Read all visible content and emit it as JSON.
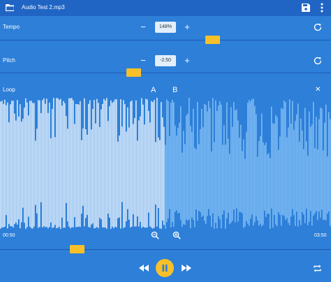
{
  "app_bar": {
    "title": "Audio Test 2.mp3",
    "open_icon": "folder-icon",
    "save_icon": "save-icon",
    "menu_icon": "more-vert-icon"
  },
  "tempo": {
    "label": "Tempo",
    "minus": "−",
    "value": "148%",
    "plus": "+",
    "slider_level": 0.65
  },
  "pitch": {
    "label": "Pitch",
    "minus": "−",
    "value": "-2.50",
    "plus": "+",
    "slider_level": 0.4
  },
  "loop": {
    "label": "Loop",
    "marker_a": "A",
    "marker_b": "B",
    "close": "✕"
  },
  "playback": {
    "time_start": "00:50",
    "time_end": "03:50",
    "position_level": 0.22,
    "state": "playing"
  },
  "colors": {
    "background": "#2d7fd8",
    "app_bar": "#2165c4",
    "accent": "#f7c02a",
    "waveform_played": "#d7e9fb",
    "waveform_unplayed": "#7cbbf4"
  }
}
